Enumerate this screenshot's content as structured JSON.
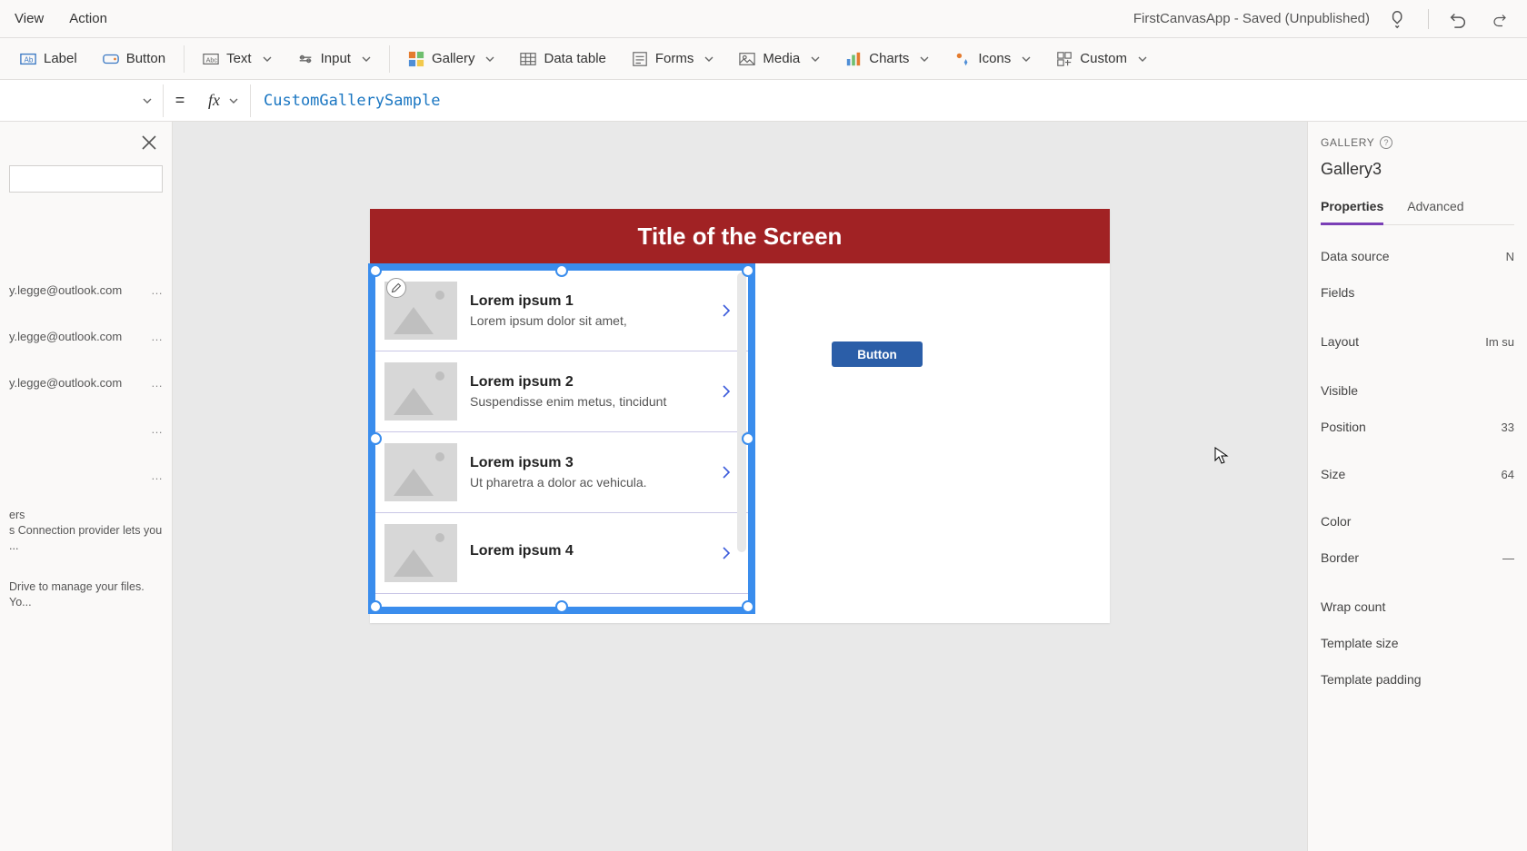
{
  "app_title": "FirstCanvasApp - Saved (Unpublished)",
  "menu": {
    "view": "View",
    "action": "Action"
  },
  "ribbon": {
    "label": "Label",
    "button": "Button",
    "text": "Text",
    "input": "Input",
    "gallery": "Gallery",
    "data_table": "Data table",
    "forms": "Forms",
    "media": "Media",
    "charts": "Charts",
    "icons": "Icons",
    "custom": "Custom"
  },
  "formula": {
    "equals": "=",
    "fx": "fx",
    "value": "CustomGallerySample"
  },
  "leftpanel": {
    "rows": [
      {
        "text": "y.legge@outlook.com"
      },
      {
        "text": "y.legge@outlook.com"
      },
      {
        "text": "y.legge@outlook.com"
      },
      {
        "text": ""
      },
      {
        "text": ""
      }
    ],
    "desc1_title": "ers",
    "desc1": "s Connection provider lets you ...",
    "desc2": "Drive to manage your files. Yo..."
  },
  "screen": {
    "title": "Title of the Screen",
    "button_label": "Button",
    "gallery": [
      {
        "title": "Lorem ipsum 1",
        "sub": "Lorem ipsum dolor sit amet,"
      },
      {
        "title": "Lorem ipsum 2",
        "sub": "Suspendisse enim metus, tincidunt"
      },
      {
        "title": "Lorem ipsum 3",
        "sub": "Ut pharetra a dolor ac vehicula."
      },
      {
        "title": "Lorem ipsum 4",
        "sub": ""
      }
    ]
  },
  "right": {
    "kind": "GALLERY",
    "name": "Gallery3",
    "tabs": {
      "properties": "Properties",
      "advanced": "Advanced"
    },
    "props": {
      "data_source": "Data source",
      "data_source_v": "N",
      "fields": "Fields",
      "layout": "Layout",
      "layout_v": "Im su",
      "visible": "Visible",
      "position": "Position",
      "position_v": "33",
      "size": "Size",
      "size_v": "64",
      "color": "Color",
      "border": "Border",
      "wrap_count": "Wrap count",
      "template_size": "Template size",
      "template_padding": "Template padding"
    }
  }
}
